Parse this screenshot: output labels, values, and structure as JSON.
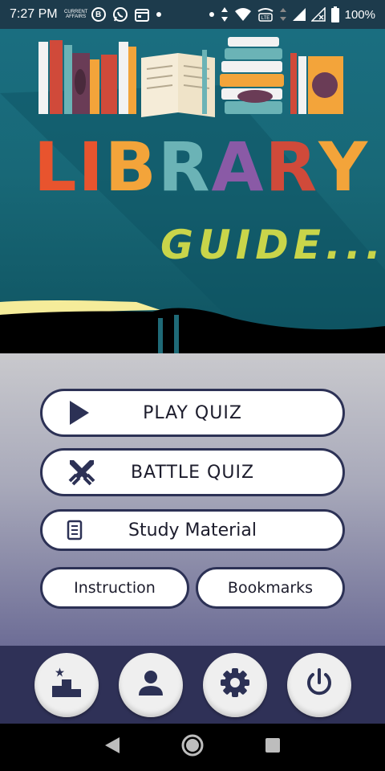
{
  "status_bar": {
    "time": "7:27 PM",
    "tiny_app_label": "CURRENT AFFAIRS",
    "b_icon_letter": "B",
    "battery_percent": "100%",
    "volte_label": "VoLTE"
  },
  "hero": {
    "title_letters": [
      "L",
      "I",
      "B",
      "R",
      "A",
      "R",
      "Y"
    ],
    "title_colors": [
      "#e8542e",
      "#e8542e",
      "#f3a43a",
      "#6bb3b6",
      "#8a5aa6",
      "#d04a3a",
      "#f3a43a"
    ],
    "subtitle": "GUIDE..."
  },
  "menu": {
    "play_quiz": "PLAY QUIZ",
    "battle_quiz": "BATTLE QUIZ",
    "study_material": "Study Material",
    "instruction": "Instruction",
    "bookmarks": "Bookmarks"
  },
  "bottom_bar": {
    "items": [
      "leaderboard-icon",
      "profile-icon",
      "settings-icon",
      "power-icon"
    ]
  },
  "nav_bar": {
    "items": [
      "back-icon",
      "home-icon",
      "recents-icon"
    ]
  },
  "colors": {
    "hero_bg": "#1a6e80",
    "subtitle": "#c9d54a",
    "button_border": "#2c3155",
    "bottom_bar_bg": "#2f3157",
    "icon_dark": "#2c3155"
  }
}
